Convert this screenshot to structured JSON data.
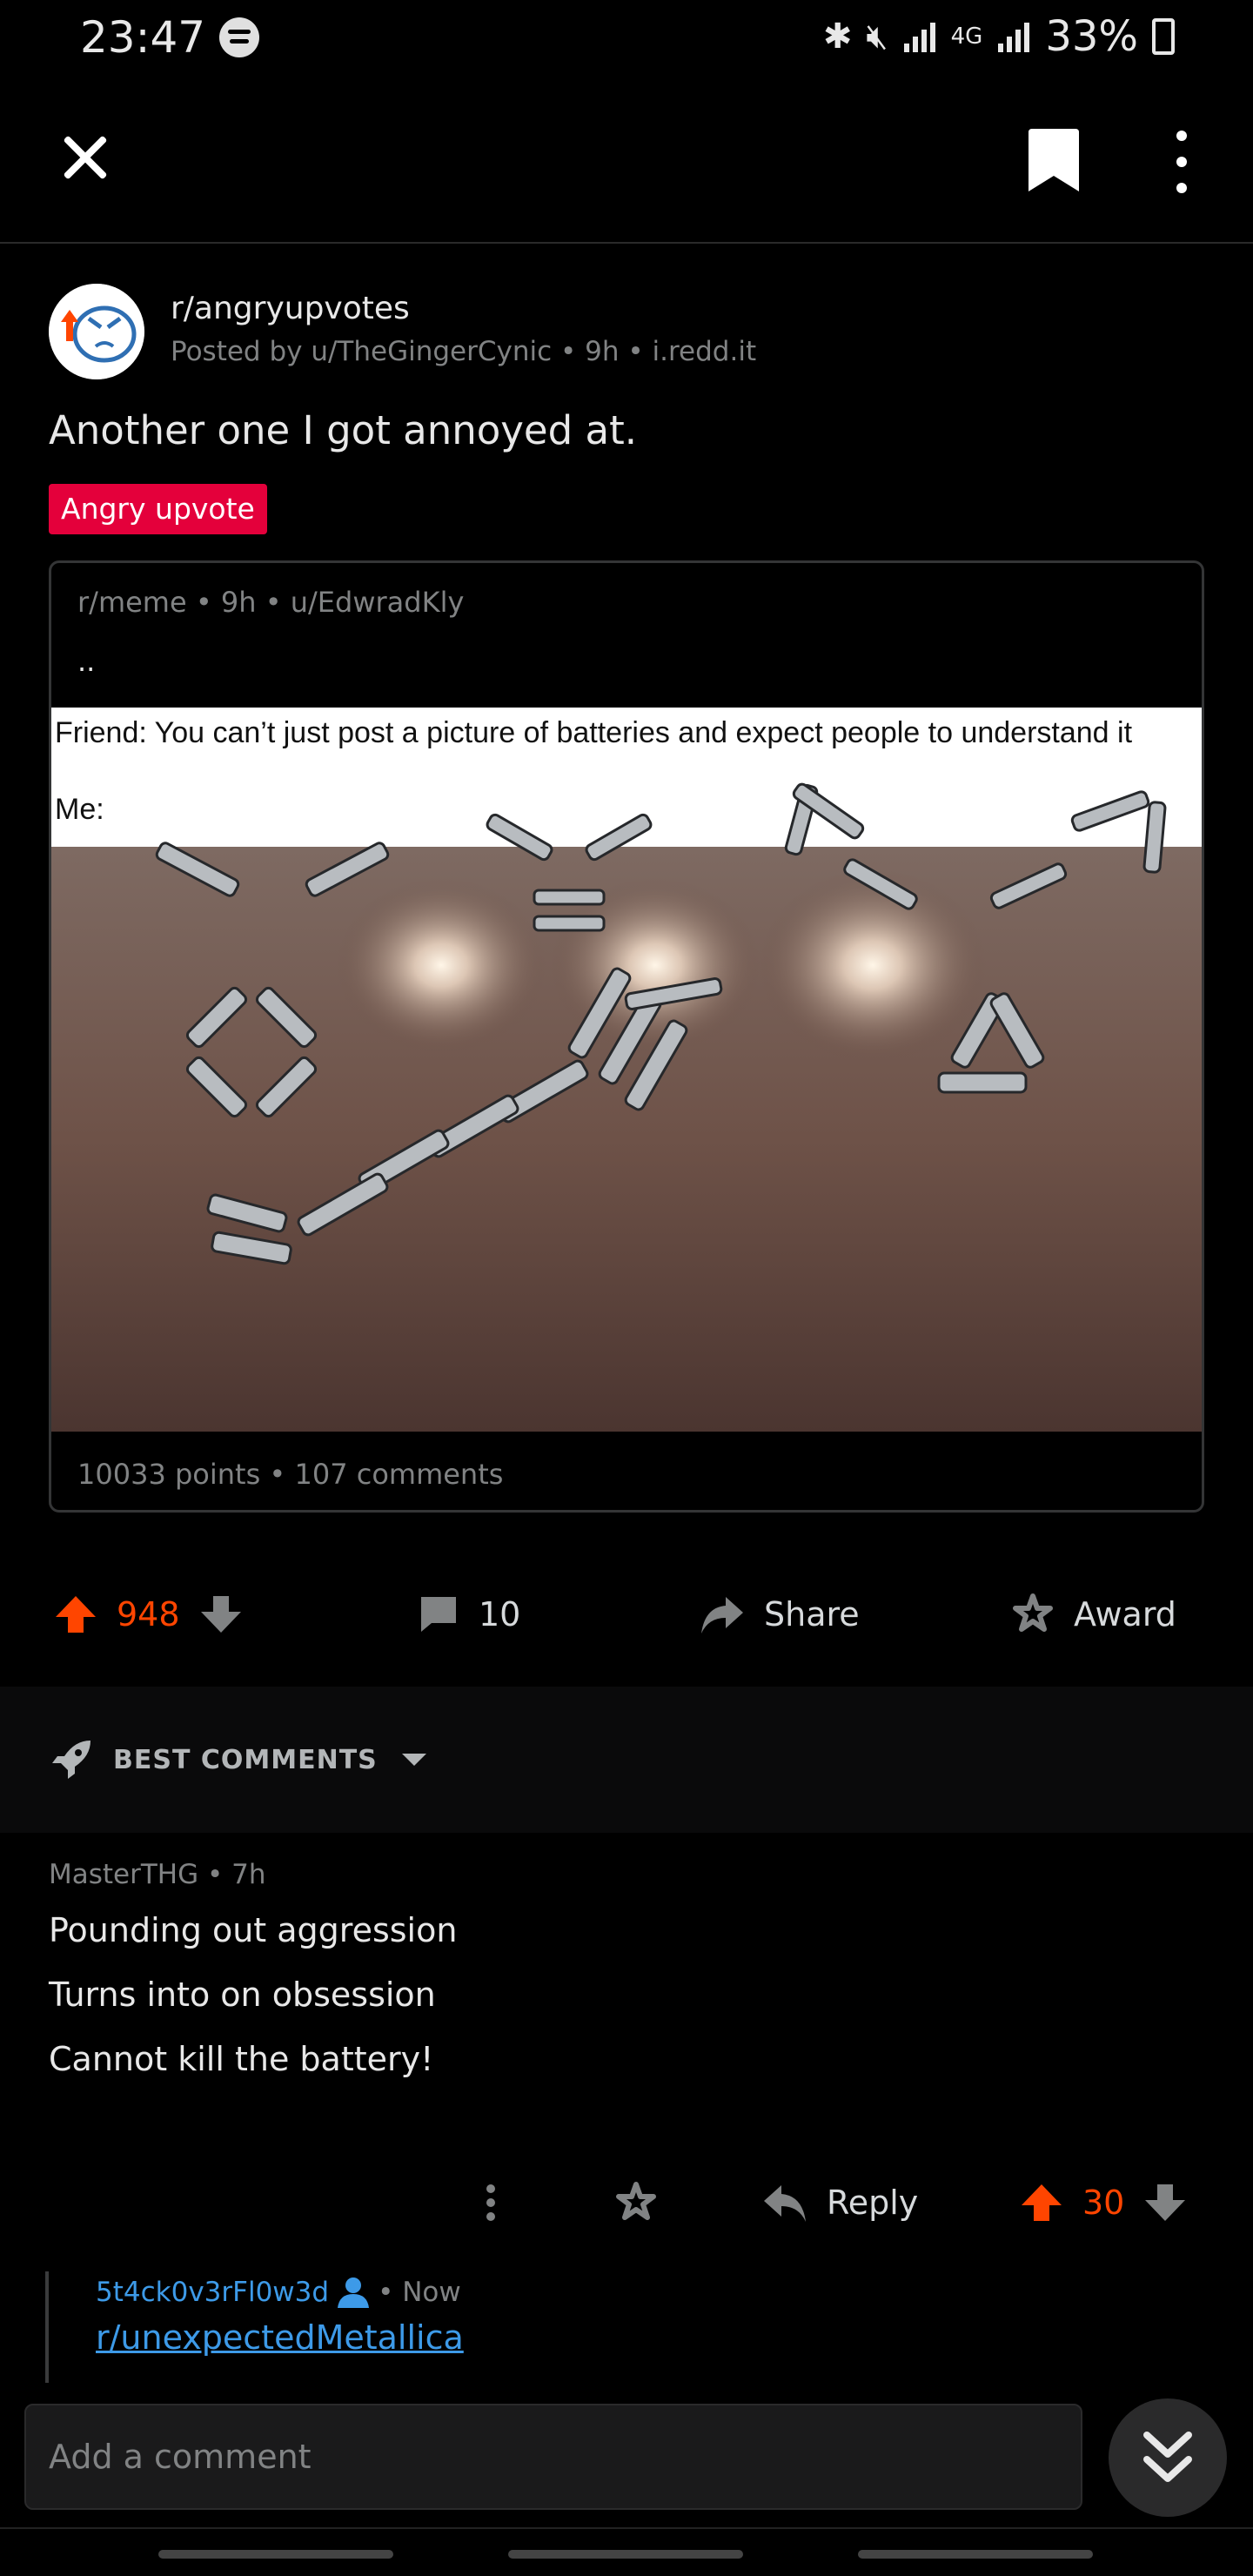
{
  "status_bar": {
    "time": "23:47",
    "network": "4G",
    "battery": "33%",
    "icons": [
      "spotify-icon",
      "bluetooth-icon",
      "mute-icon",
      "signal-icon",
      "battery-charging-icon"
    ]
  },
  "toolbar": {
    "icons": [
      "close-icon",
      "bookmark-icon",
      "more-icon"
    ]
  },
  "post": {
    "subreddit": "r/angryupvotes",
    "meta": "Posted by u/TheGingerCynic • 9h • i.redd.it",
    "title": "Another one I got annoyed at.",
    "flair": "Angry upvote",
    "flair_color": "#e4003b",
    "crosspost": {
      "meta": "r/meme • 9h • u/EdwradKly",
      "title": "..",
      "image_caption_line1": "Friend: You can’t just post a picture of batteries and expect people to understand it",
      "image_caption_line2": "Me:",
      "stats": "10033 points • 107 comments"
    },
    "votes": "948",
    "comments": "10",
    "share_label": "Share",
    "award_label": "Award"
  },
  "sort": {
    "label": "BEST COMMENTS"
  },
  "comment": {
    "author_meta": "MasterTHG • 7h",
    "lines": [
      "Pounding out aggression",
      "Turns into on obsession",
      "Cannot kill the battery!"
    ],
    "reply_label": "Reply",
    "votes": "30"
  },
  "reply": {
    "author": "5t4ck0v3rFl0w3d",
    "time": "• Now",
    "link": "r/unexpectedMetallica"
  },
  "composer": {
    "placeholder": "Add a comment"
  },
  "colors": {
    "upvote": "#ff4500",
    "link": "#3d9ae8",
    "background": "#000000"
  }
}
